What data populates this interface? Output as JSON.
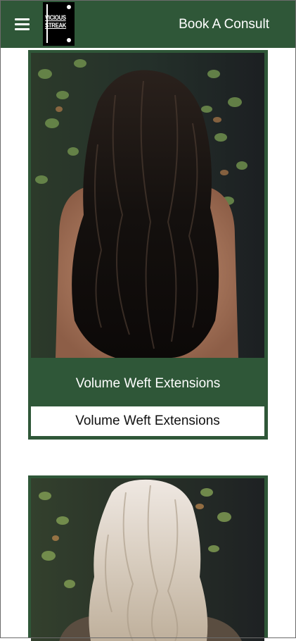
{
  "header": {
    "menu_icon": "hamburger-menu-icon",
    "logo": {
      "line1": "VICIOUS",
      "line2": "STREAK"
    },
    "cta_label": "Book A Consult",
    "background": "#2f5738"
  },
  "cards": [
    {
      "caption": "Volume Weft Extensions",
      "button_label": "Volume Weft Extensions",
      "photo": "dark-long-wavy-hair-photo"
    },
    {
      "photo": "blonde-wavy-hair-photo"
    }
  ],
  "colors": {
    "accent": "#2f5738",
    "text_light": "#ffffff"
  }
}
